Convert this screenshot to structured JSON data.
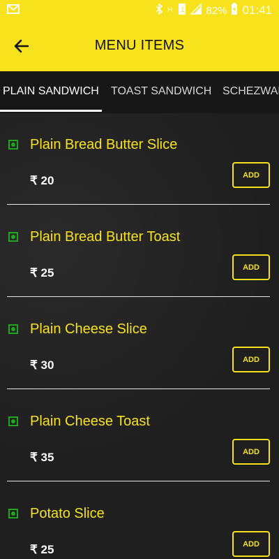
{
  "status_bar": {
    "battery": "82%",
    "time": "01:41",
    "icons": [
      "email-icon",
      "bluetooth-icon",
      "signal-h-icon",
      "sim-1-icon",
      "signal-icon",
      "battery-charging-icon"
    ]
  },
  "app_bar": {
    "title": "MENU ITEMS",
    "back_icon": "arrow-left-icon"
  },
  "tabs": [
    {
      "label": "PLAIN SANDWICH",
      "active": true
    },
    {
      "label": "TOAST SANDWICH",
      "active": false
    },
    {
      "label": "SCHEZWAN",
      "active": false
    }
  ],
  "menu_items": [
    {
      "name": "Plain Bread Butter Slice",
      "price": "₹ 20",
      "add_label": "ADD"
    },
    {
      "name": "Plain Bread Butter Toast",
      "price": "₹ 25",
      "add_label": "ADD"
    },
    {
      "name": "Plain Cheese Slice",
      "price": "₹ 30",
      "add_label": "ADD"
    },
    {
      "name": "Plain Cheese Toast",
      "price": "₹ 35",
      "add_label": "ADD"
    },
    {
      "name": "Potato Slice",
      "price": "₹ 25",
      "add_label": "ADD"
    }
  ],
  "colors": {
    "accent": "#f7e21b",
    "background": "#1f1f1f",
    "veg_indicator": "#1fa81f"
  }
}
